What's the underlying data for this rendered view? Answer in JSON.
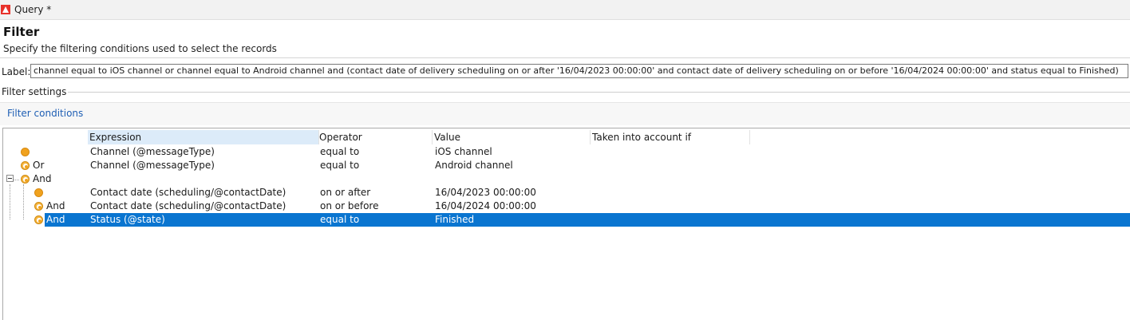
{
  "window": {
    "title": "Query *"
  },
  "header": {
    "title": "Filter",
    "subtitle": "Specify the filtering conditions used to select the records"
  },
  "label_field": {
    "label": "Label:",
    "value": "channel equal to iOS channel or channel equal to Android channel and (contact date of delivery scheduling on or after '16/04/2023 00:00:00' and contact date of delivery scheduling on or before '16/04/2024 00:00:00' and status equal to Finished)"
  },
  "filter_settings": {
    "legend": "Filter settings",
    "tab": "Filter conditions"
  },
  "grid": {
    "columns": [
      "Expression",
      "Operator",
      "Value",
      "Taken into account if"
    ],
    "rows": [
      {
        "conj": "",
        "expression": "Channel (@messageType)",
        "operator": "equal to",
        "value": "iOS channel",
        "icon": "full-circle-icon"
      },
      {
        "conj": "Or",
        "expression": "Channel (@messageType)",
        "operator": "equal to",
        "value": "Android channel",
        "icon": "half-circle-icon"
      },
      {
        "conj": "And",
        "expression": "",
        "operator": "",
        "value": "",
        "icon": "half-circle-icon"
      },
      {
        "conj": "",
        "expression": "Contact date (scheduling/@contactDate)",
        "operator": "on or after",
        "value": "16/04/2023 00:00:00",
        "icon": "full-circle-icon"
      },
      {
        "conj": "And",
        "expression": "Contact date (scheduling/@contactDate)",
        "operator": "on or before",
        "value": "16/04/2024 00:00:00",
        "icon": "half-circle-icon"
      },
      {
        "conj": "And",
        "expression": "Status (@state)",
        "operator": "equal to",
        "value": "Finished",
        "icon": "half-circle-icon",
        "selected": true
      }
    ]
  },
  "colors": {
    "accent": "#0a75d0",
    "link": "#1f5fb4",
    "icon_orange": "#f0a21e"
  }
}
